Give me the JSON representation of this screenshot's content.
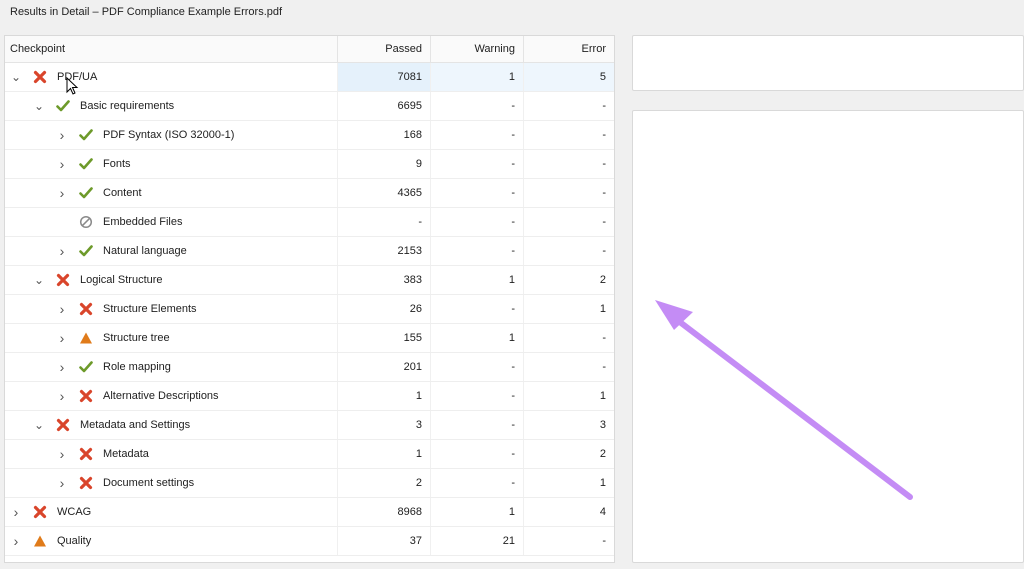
{
  "window": {
    "title": "Results in Detail – PDF Compliance Example Errors.pdf"
  },
  "columns": {
    "checkpoint": "Checkpoint",
    "passed": "Passed",
    "warning": "Warning",
    "error": "Error"
  },
  "colors": {
    "pass": "#6d9a2a",
    "error": "#d9452b",
    "warning": "#e07b1a",
    "neutral": "#8a8a8a",
    "arrow": "#c48cf5"
  },
  "rows": [
    {
      "label": "PDF/UA",
      "level": 0,
      "expanded": true,
      "status": "error",
      "passed": "7081",
      "warning": "1",
      "error": "5",
      "selected": true
    },
    {
      "label": "Basic requirements",
      "level": 1,
      "expanded": true,
      "status": "pass",
      "passed": "6695",
      "warning": "-",
      "error": "-"
    },
    {
      "label": "PDF Syntax (ISO 32000-1)",
      "level": 2,
      "expanded": false,
      "status": "pass",
      "passed": "168",
      "warning": "-",
      "error": "-"
    },
    {
      "label": "Fonts",
      "level": 2,
      "expanded": false,
      "status": "pass",
      "passed": "9",
      "warning": "-",
      "error": "-"
    },
    {
      "label": "Content",
      "level": 2,
      "expanded": false,
      "status": "pass",
      "passed": "4365",
      "warning": "-",
      "error": "-"
    },
    {
      "label": "Embedded Files",
      "level": 2,
      "expanded": false,
      "status": "skipped",
      "passed": "-",
      "warning": "-",
      "error": "-",
      "no_expander": true
    },
    {
      "label": "Natural language",
      "level": 2,
      "expanded": false,
      "status": "pass",
      "passed": "2153",
      "warning": "-",
      "error": "-"
    },
    {
      "label": "Logical Structure",
      "level": 1,
      "expanded": true,
      "status": "error",
      "passed": "383",
      "warning": "1",
      "error": "2"
    },
    {
      "label": "Structure Elements",
      "level": 2,
      "expanded": false,
      "status": "error",
      "passed": "26",
      "warning": "-",
      "error": "1"
    },
    {
      "label": "Structure tree",
      "level": 2,
      "expanded": false,
      "status": "warning",
      "passed": "155",
      "warning": "1",
      "error": "-"
    },
    {
      "label": "Role mapping",
      "level": 2,
      "expanded": false,
      "status": "pass",
      "passed": "201",
      "warning": "-",
      "error": "-"
    },
    {
      "label": "Alternative Descriptions",
      "level": 2,
      "expanded": false,
      "status": "error",
      "passed": "1",
      "warning": "-",
      "error": "1"
    },
    {
      "label": "Metadata and Settings",
      "level": 1,
      "expanded": true,
      "status": "error",
      "passed": "3",
      "warning": "-",
      "error": "3"
    },
    {
      "label": "Metadata",
      "level": 2,
      "expanded": false,
      "status": "error",
      "passed": "1",
      "warning": "-",
      "error": "2"
    },
    {
      "label": "Document settings",
      "level": 2,
      "expanded": false,
      "status": "error",
      "passed": "2",
      "warning": "-",
      "error": "1"
    },
    {
      "label": "WCAG",
      "level": 0,
      "expanded": false,
      "status": "error",
      "passed": "8968",
      "warning": "1",
      "error": "4"
    },
    {
      "label": "Quality",
      "level": 0,
      "expanded": false,
      "status": "warning",
      "passed": "37",
      "warning": "21",
      "error": "-"
    }
  ]
}
